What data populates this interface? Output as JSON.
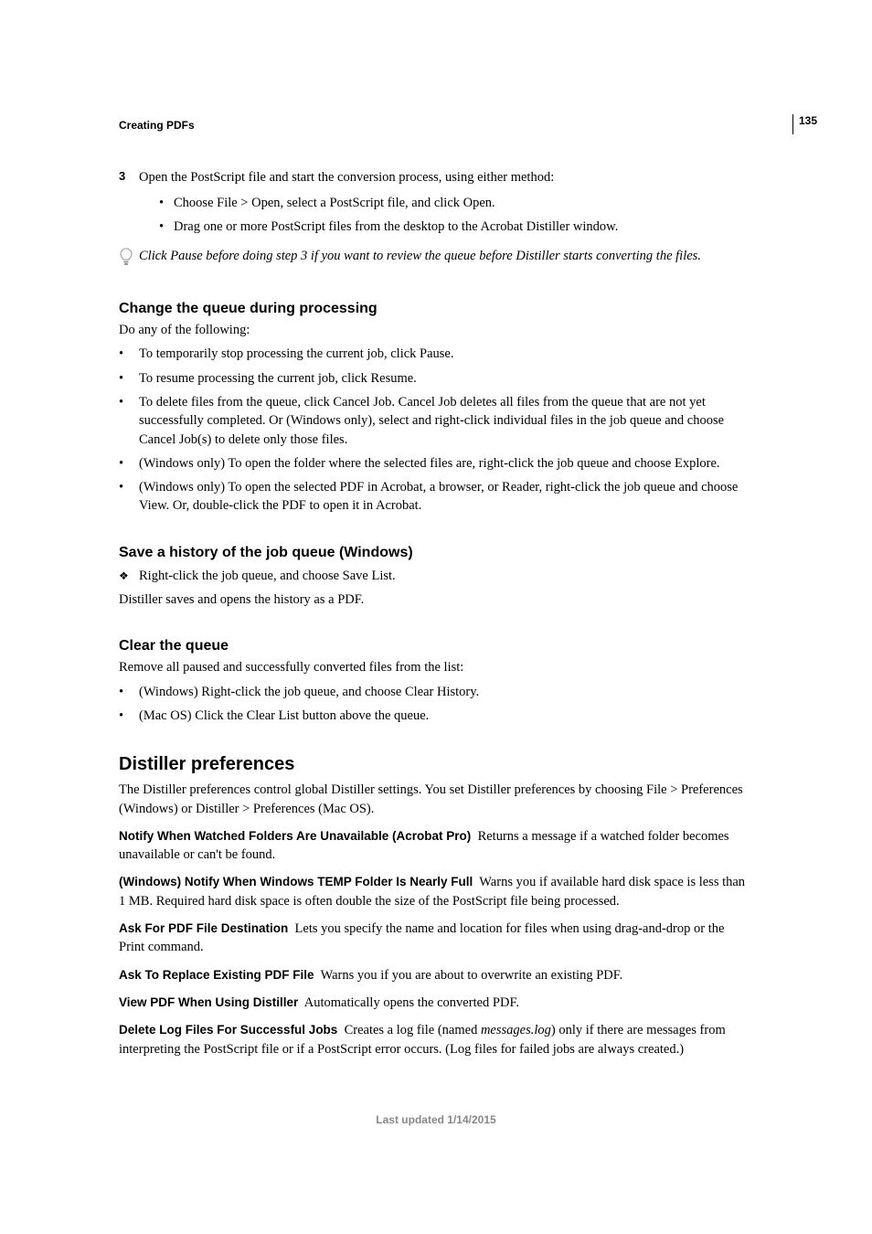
{
  "page_number": "135",
  "header": "Creating PDFs",
  "step3": {
    "num": "3",
    "text": "Open the PostScript file and start the conversion process, using either method:",
    "subs": [
      "Choose File > Open, select a PostScript file, and click Open.",
      "Drag one or more PostScript files from the desktop to the Acrobat Distiller window."
    ]
  },
  "tip": "Click Pause before doing step 3 if you want to review the queue before Distiller starts converting the files.",
  "change_queue": {
    "heading": "Change the queue during processing",
    "intro": "Do any of the following:",
    "items": [
      "To temporarily stop processing the current job, click Pause.",
      "To resume processing the current job, click Resume.",
      "To delete files from the queue, click Cancel Job. Cancel Job deletes all files from the queue that are not yet successfully completed. Or (Windows only), select and right-click individual files in the job queue and choose Cancel Job(s) to delete only those files.",
      "(Windows only) To open the folder where the selected files are, right-click the job queue and choose Explore.",
      "(Windows only) To open the selected PDF in Acrobat, a browser, or Reader, right-click the job queue and choose View. Or, double-click the PDF to open it in Acrobat."
    ]
  },
  "save_history": {
    "heading": "Save a history of the job queue (Windows)",
    "action": "Right-click the job queue, and choose Save List.",
    "note": "Distiller saves and opens the history as a PDF."
  },
  "clear_queue": {
    "heading": "Clear the queue",
    "intro": "Remove all paused and successfully converted files from the list:",
    "items": [
      "(Windows) Right-click the job queue, and choose Clear History.",
      "(Mac OS) Click the Clear List button above the queue."
    ]
  },
  "preferences": {
    "heading": "Distiller preferences",
    "intro": "The Distiller preferences control global Distiller settings. You set Distiller preferences by choosing File > Preferences (Windows) or Distiller > Preferences (Mac OS).",
    "terms": [
      {
        "term": "Notify When Watched Folders Are Unavailable (Acrobat Pro)",
        "desc": "Returns a message if a watched folder becomes unavailable or can't be found."
      },
      {
        "term": "(Windows) Notify When Windows TEMP Folder Is Nearly Full",
        "desc": "Warns you if available hard disk space is less than 1 MB. Required hard disk space is often double the size of the PostScript file being processed."
      },
      {
        "term": "Ask For PDF File Destination",
        "desc": "Lets you specify the name and location for files when using drag-and-drop or the Print command."
      },
      {
        "term": "Ask To Replace Existing PDF File",
        "desc": "Warns you if you are about to overwrite an existing PDF."
      },
      {
        "term": "View PDF When Using Distiller",
        "desc": "Automatically opens the converted PDF."
      }
    ],
    "delete_logs": {
      "term": "Delete Log Files For Successful Jobs",
      "pre": "Creates a log file (named ",
      "file": "messages.log",
      "post": ") only if there are messages from interpreting the PostScript file or if a PostScript error occurs. (Log files for failed jobs are always created.)"
    }
  },
  "footer": "Last updated 1/14/2015"
}
